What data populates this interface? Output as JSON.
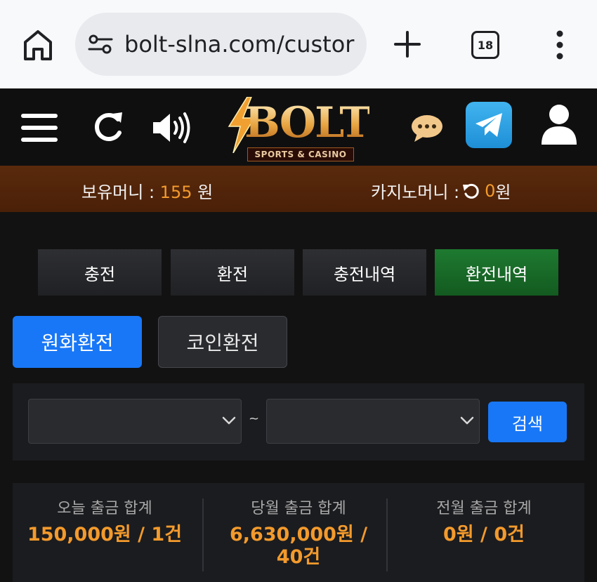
{
  "browser": {
    "url": "bolt-slna.com/custor",
    "tab_count": "18"
  },
  "site": {
    "logo_text": "BOLT",
    "logo_subtext": "SPORTS & CASINO"
  },
  "money": {
    "holding_label": "보유머니 : ",
    "holding_amount": "155",
    "holding_unit": " 원",
    "casino_label": "카지노머니 : ",
    "casino_amount": "0",
    "casino_unit": " 원"
  },
  "tabs": [
    {
      "label": "충전",
      "active": false
    },
    {
      "label": "환전",
      "active": false
    },
    {
      "label": "충전내역",
      "active": false
    },
    {
      "label": "환전내역",
      "active": true
    }
  ],
  "sub_tabs": [
    {
      "label": "원화환전",
      "active": true
    },
    {
      "label": "코인환전",
      "active": false
    }
  ],
  "search": {
    "start_date": "",
    "end_date": "",
    "separator": "~",
    "button_label": "검색"
  },
  "summary": [
    {
      "label": "오늘 출금 합계",
      "value": "150,000원 / 1건"
    },
    {
      "label": "당월 출금 합계",
      "value": "6,630,000원 / 40건"
    },
    {
      "label": "전월 출금 합계",
      "value": "0원 / 0건"
    }
  ],
  "colors": {
    "accent_blue": "#1877f6",
    "active_tab_green": "#1e7a30",
    "amount_orange": "#f39a2c",
    "money_bar_brown": "#5a2a0c"
  }
}
